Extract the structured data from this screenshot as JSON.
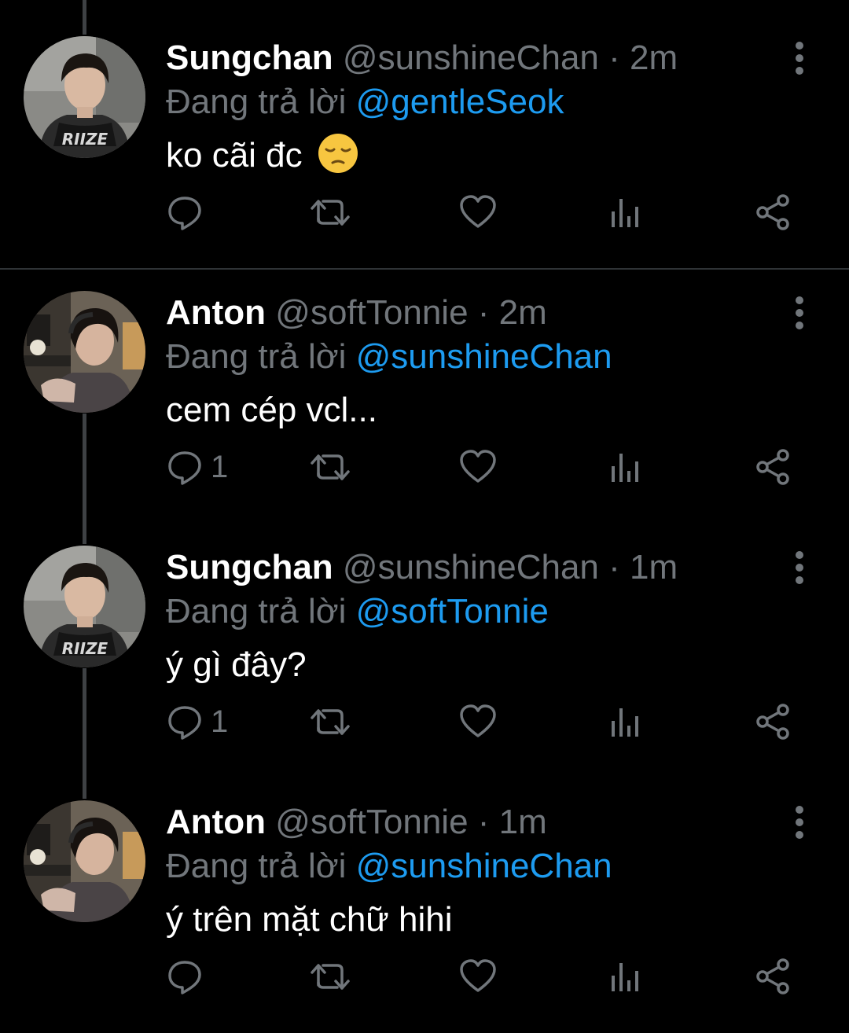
{
  "colors": {
    "background": "#000000",
    "name": "#ffffff",
    "muted": "#71767b",
    "mention": "#1d9bf0",
    "divider": "#2f3336",
    "thread_line": "#3e4144"
  },
  "tweets": [
    {
      "author": "Sungchan",
      "handle": "@sunshineChan",
      "separator": "·",
      "time": "2m",
      "replying_prefix": "Đang trả lời",
      "replying_to": "@gentleSeok",
      "text": "ko cãi đc",
      "emoji": "pensive-face",
      "reply_count": "",
      "avatar": "sungchan-avatar"
    },
    {
      "author": "Anton",
      "handle": "@softTonnie",
      "separator": "·",
      "time": "2m",
      "replying_prefix": "Đang trả lời",
      "replying_to": "@sunshineChan",
      "text": "cem cép vcl...",
      "reply_count": "1",
      "avatar": "anton-avatar"
    },
    {
      "author": "Sungchan",
      "handle": "@sunshineChan",
      "separator": "·",
      "time": "1m",
      "replying_prefix": "Đang trả lời",
      "replying_to": "@softTonnie",
      "text": "ý gì đây?",
      "reply_count": "1",
      "avatar": "sungchan-avatar"
    },
    {
      "author": "Anton",
      "handle": "@softTonnie",
      "separator": "·",
      "time": "1m",
      "replying_prefix": "Đang trả lời",
      "replying_to": "@sunshineChan",
      "text": "ý trên mặt chữ hihi",
      "reply_count": "",
      "avatar": "anton-avatar"
    }
  ],
  "icons": {
    "reply": "reply-icon",
    "retweet": "retweet-icon",
    "like": "heart-icon",
    "views": "views-icon",
    "share": "share-icon",
    "more": "more-vertical-icon"
  }
}
